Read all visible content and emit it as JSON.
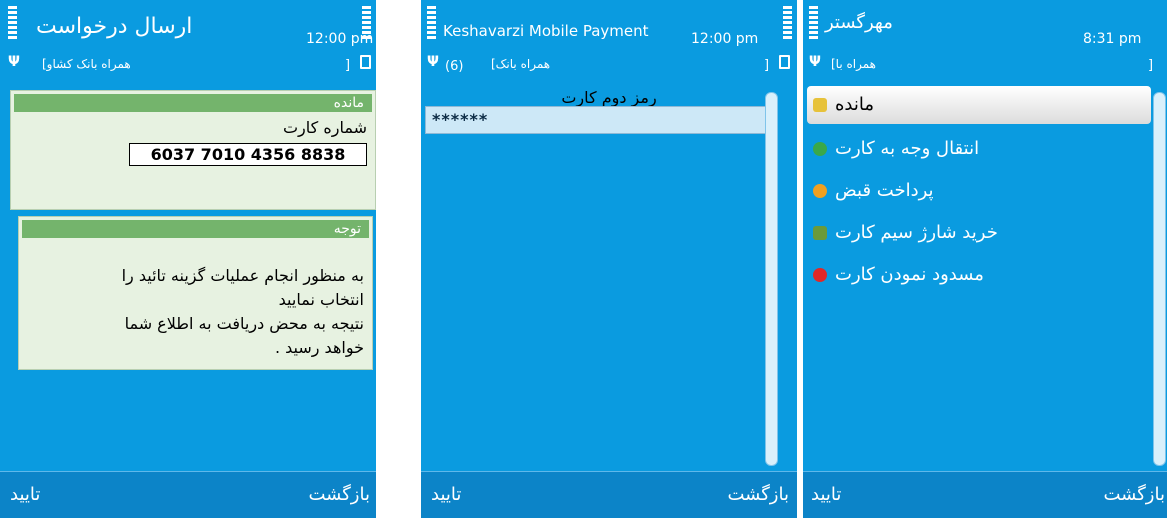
{
  "screen1": {
    "title": "ارسال درخواست",
    "time": "12:00 pm",
    "subtitle": "همراه بانک کشاو]",
    "bracket": "]",
    "balance_box": {
      "header": "مانده",
      "label": "شماره کارت",
      "card_number": "6037 7010 4356 8838"
    },
    "note_box": {
      "header": "توجه",
      "lines": [
        "به منظور انجام عملیات گزینه تائید را",
        "انتخاب نمایید",
        "نتیجه به محض دریافت به اطلاع شما",
        "خواهد رسید ."
      ]
    },
    "soft_left": "تایید",
    "soft_right": "بازگشت"
  },
  "screen2": {
    "title": "Keshavarzi Mobile Payment",
    "time": "12:00 pm",
    "count": "(6)",
    "subtitle": "همراه بانک]",
    "bracket": "]",
    "field_label": "رمز دوم کارت",
    "field_value": "******",
    "soft_left": "تایید",
    "soft_right": "بازگشت"
  },
  "screen3": {
    "title": "مهرگستر",
    "time": "8:31 pm",
    "subtitle": "همراه با]",
    "bracket": "]",
    "menu": [
      {
        "label": "مانده",
        "icon": "balance-icon",
        "color": "#e7c23a"
      },
      {
        "label": "انتقال وجه به کارت",
        "icon": "transfer-icon",
        "color": "#3aa84a"
      },
      {
        "label": "پرداخت قبض",
        "icon": "bill-icon",
        "color": "#f0a020"
      },
      {
        "label": "خرید شارژ سیم کارت",
        "icon": "sim-charge-icon",
        "color": "#6a9a3a"
      },
      {
        "label": "مسدود نمودن کارت",
        "icon": "block-card-icon",
        "color": "#e02828"
      }
    ],
    "soft_left": "تایید",
    "soft_right": "بازگشت"
  }
}
